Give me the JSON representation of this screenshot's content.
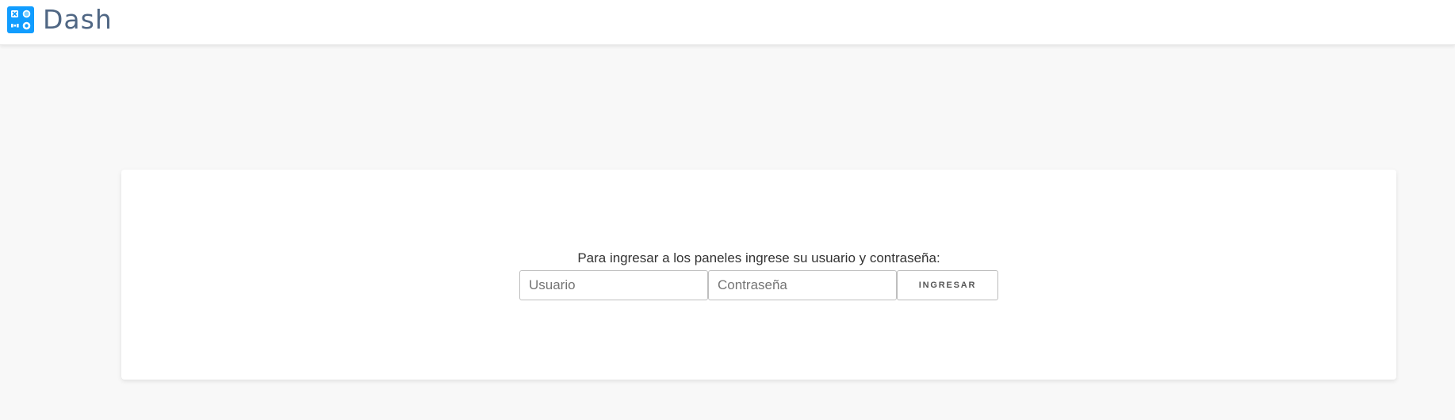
{
  "header": {
    "brand_name": "Dash",
    "brand_icon": "dash-logo-icon",
    "brand_color": "#119dff"
  },
  "login": {
    "prompt": "Para ingresar a los paneles ingrese su usuario y contraseña:",
    "username_placeholder": "Usuario",
    "password_placeholder": "Contraseña",
    "submit_label": "INGRESAR"
  }
}
